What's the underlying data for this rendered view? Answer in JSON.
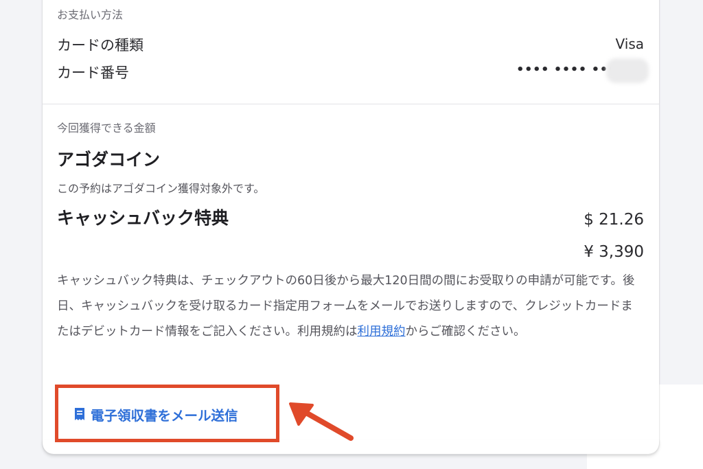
{
  "payment": {
    "section_title": "お支払い方法",
    "card_type_label": "カードの種類",
    "card_type_value": "Visa",
    "card_number_label": "カード番号",
    "card_number_masked": "•••• •••• ••••"
  },
  "earnings": {
    "section_title": "今回獲得できる金額",
    "coin_heading": "アゴダコイン",
    "coin_note": "この予約はアゴダコイン獲得対象外です。",
    "cashback_heading": "キャッシュバック特典",
    "cashback_usd": "$ 21.26",
    "cashback_jpy": "¥ 3,390",
    "description_part1": "キャッシュバック特典は、チェックアウトの60日後から最大120日間の間にお受取りの申請が可能です。後日、キャッシュバックを受け取るカード指定用フォームをメールでお送りしますので、クレジットカードまたはデビットカード情報をご記入ください。利用規約は",
    "terms_link": "利用規約",
    "description_part2": "からご確認ください。"
  },
  "actions": {
    "email_receipt_label": "電子領収書をメール送信",
    "email_receipt_icon": "receipt-icon"
  },
  "colors": {
    "link": "#2e6fd8",
    "highlight": "#e04a2a"
  }
}
